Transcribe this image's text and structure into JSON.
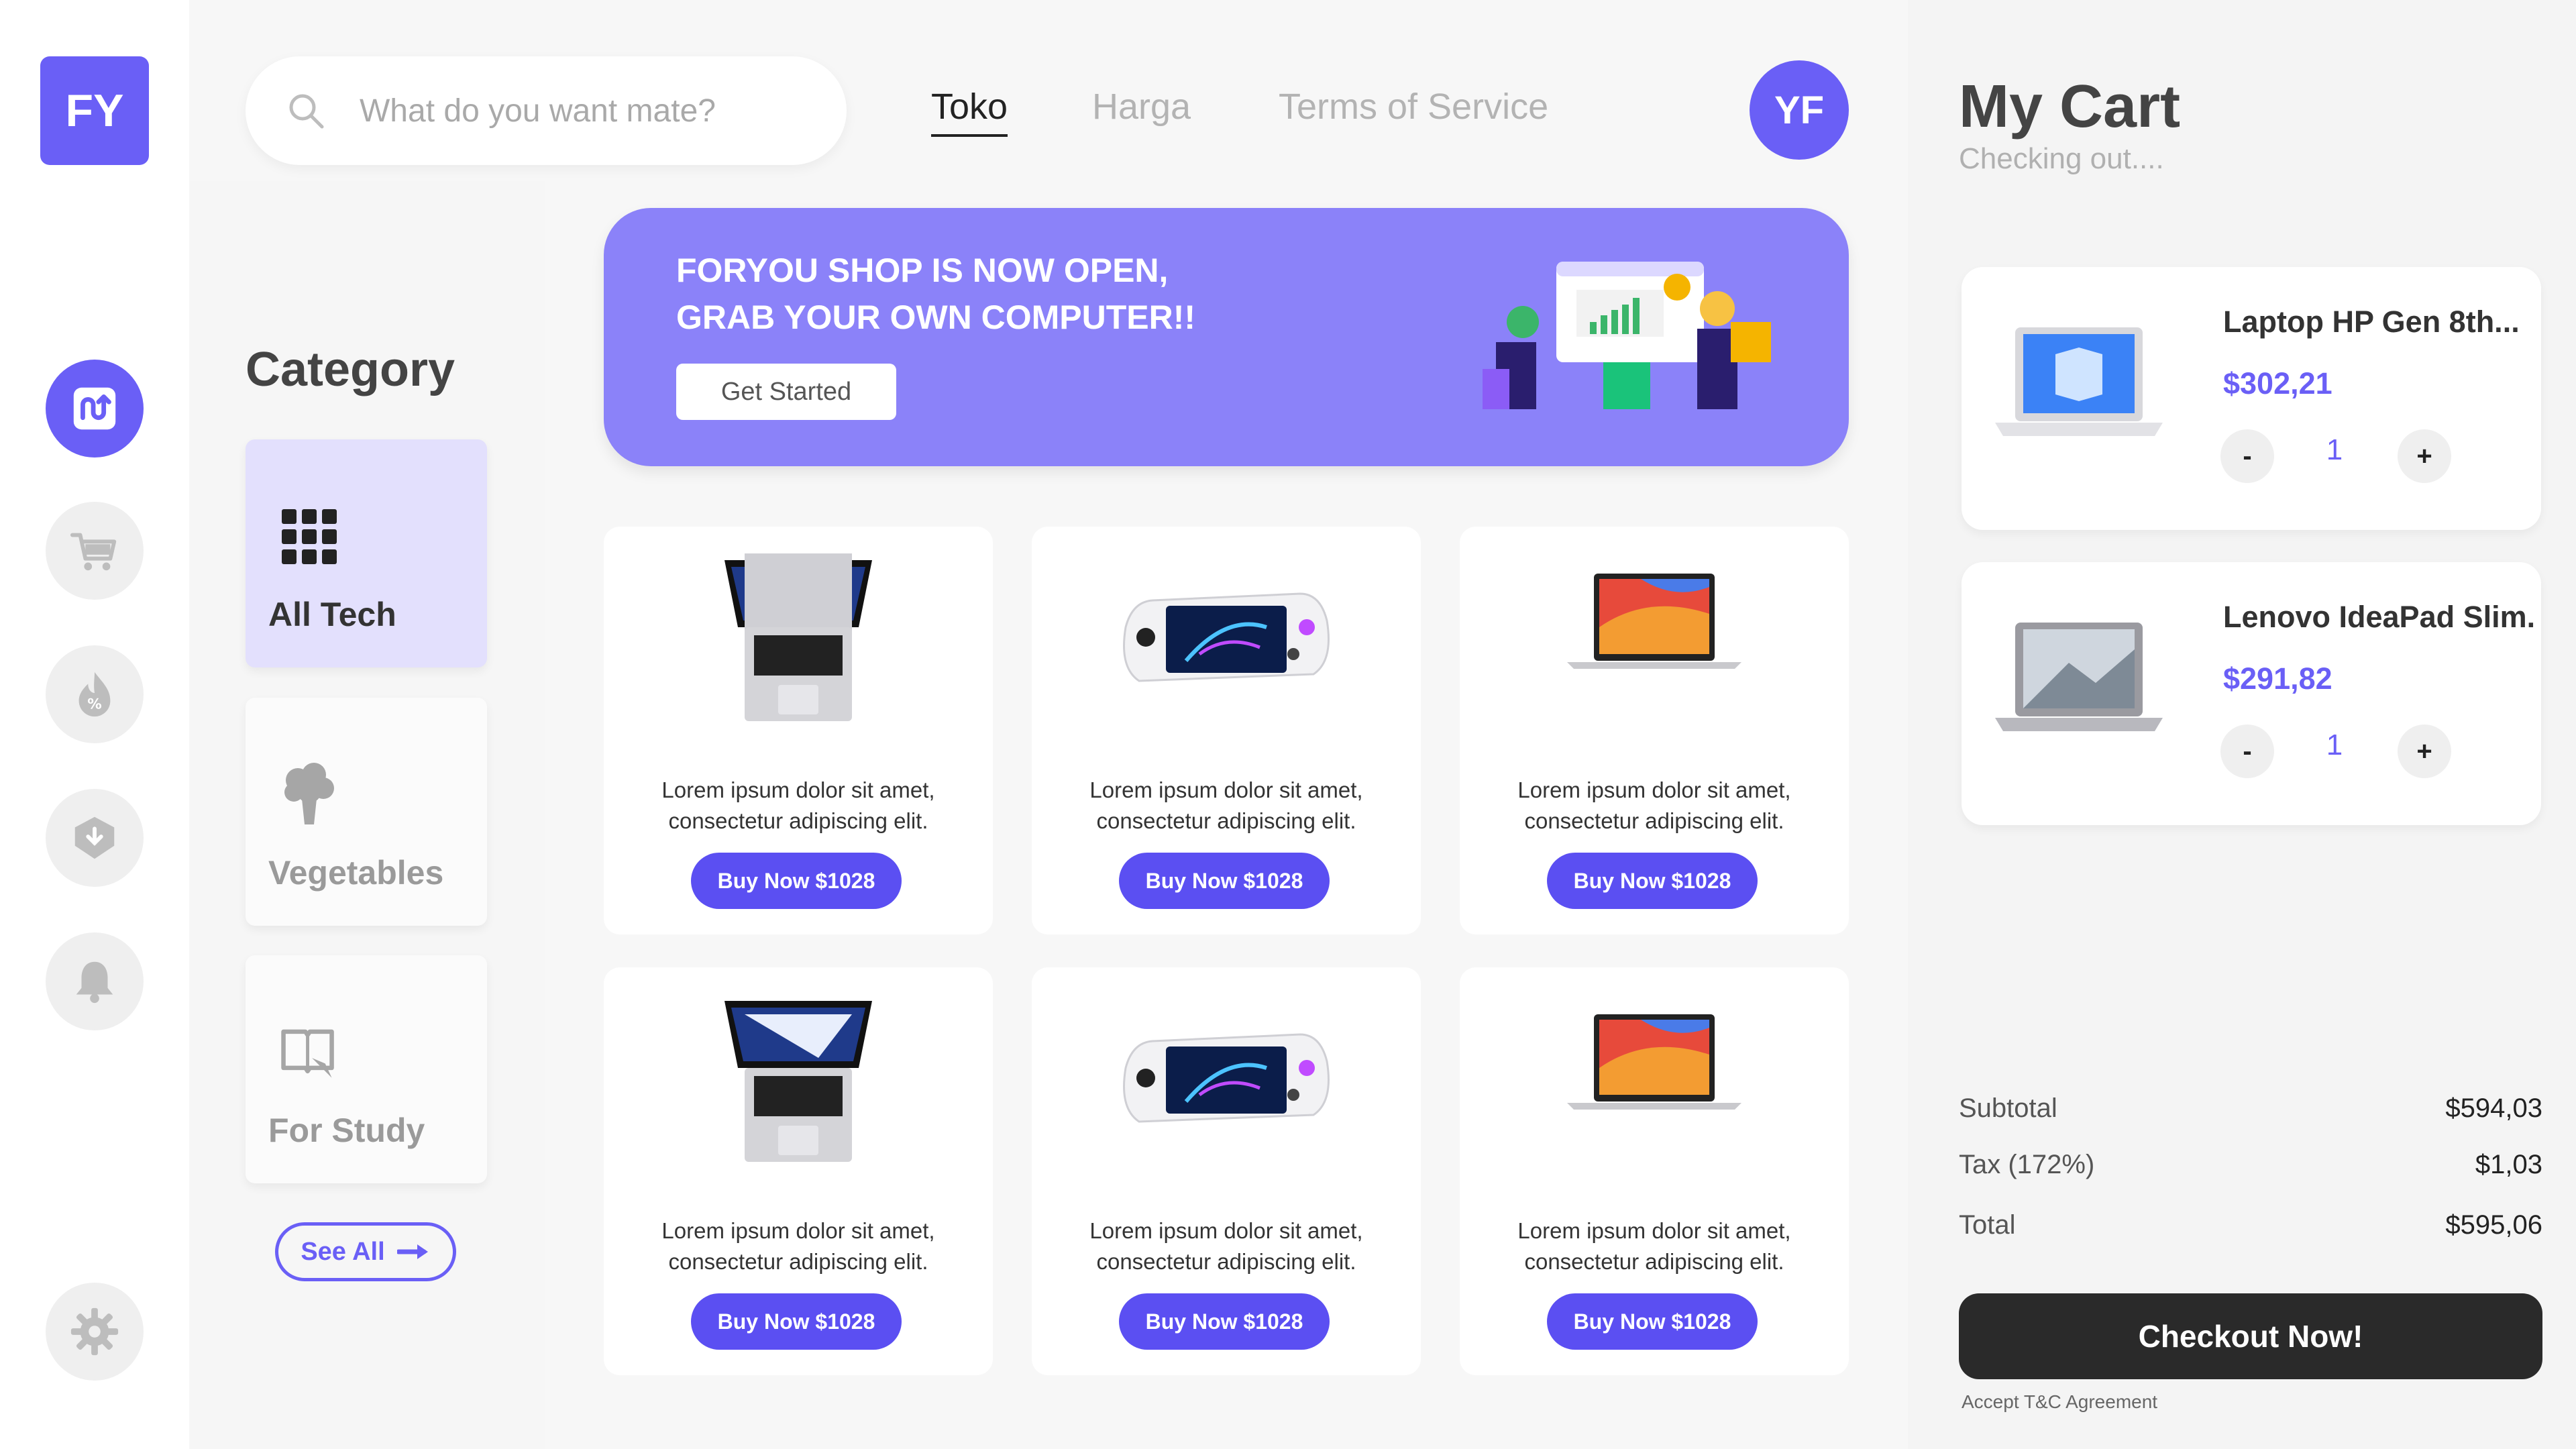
{
  "brand": {
    "logo_text": "FY",
    "accent": "#6a5ff6"
  },
  "rail": {
    "items": [
      {
        "icon": "exchange-icon",
        "active": true
      },
      {
        "icon": "cart-icon",
        "active": false
      },
      {
        "icon": "discount-fire-icon",
        "active": false
      },
      {
        "icon": "box-icon",
        "active": false
      },
      {
        "icon": "bell-icon",
        "active": false
      },
      {
        "icon": "gear-icon",
        "active": false
      }
    ]
  },
  "search": {
    "placeholder": "What do you want mate?"
  },
  "nav": {
    "items": [
      "Toko",
      "Harga",
      "Terms of Service"
    ],
    "active": "Toko"
  },
  "user": {
    "initials": "YF"
  },
  "category": {
    "title": "Category",
    "items": [
      {
        "label": "All Tech",
        "icon": "grid-icon",
        "active": true
      },
      {
        "label": "Vegetables",
        "icon": "broccoli-icon",
        "active": false
      },
      {
        "label": "For Study",
        "icon": "study-icon",
        "active": false
      }
    ],
    "see_all": "See All"
  },
  "banner": {
    "headline": "FORYOU SHOP IS NOW OPEN,\nGRAB YOUR OWN COMPUTER!!",
    "cta": "Get Started"
  },
  "products": [
    {
      "image": "macbook-pro-icon",
      "desc": "Lorem ipsum dolor sit amet, consectetur adipiscing elit.",
      "button": "Buy Now $1028"
    },
    {
      "image": "handheld-console-icon",
      "desc": "Lorem ipsum dolor sit amet, consectetur adipiscing elit.",
      "button": "Buy Now $1028"
    },
    {
      "image": "macbook-air-icon",
      "desc": "Lorem ipsum dolor sit amet, consectetur adipiscing elit.",
      "button": "Buy Now $1028"
    },
    {
      "image": "macbook-pro-icon",
      "desc": "Lorem ipsum dolor sit amet, consectetur adipiscing elit.",
      "button": "Buy Now $1028"
    },
    {
      "image": "handheld-console-icon",
      "desc": "Lorem ipsum dolor sit amet, consectetur adipiscing elit.",
      "button": "Buy Now $1028"
    },
    {
      "image": "macbook-air-icon",
      "desc": "Lorem ipsum dolor sit amet, consectetur adipiscing elit.",
      "button": "Buy Now $1028"
    }
  ],
  "cart": {
    "title": "My Cart",
    "subtitle": "Checking out....",
    "items": [
      {
        "name": "Laptop HP Gen 8th...",
        "price": "$302,21",
        "qty": "1",
        "minus": "-",
        "plus": "+"
      },
      {
        "name": "Lenovo IdeaPad Slim.",
        "price": "$291,82",
        "qty": "1",
        "minus": "-",
        "plus": "+"
      }
    ],
    "summary": {
      "subtotal_label": "Subtotal",
      "subtotal": "$594,03",
      "tax_label": "Tax (172%)",
      "tax": "$1,03",
      "total_label": "Total",
      "total": "$595,06"
    },
    "checkout": "Checkout Now!",
    "terms": "Accept T&C Agreement"
  }
}
